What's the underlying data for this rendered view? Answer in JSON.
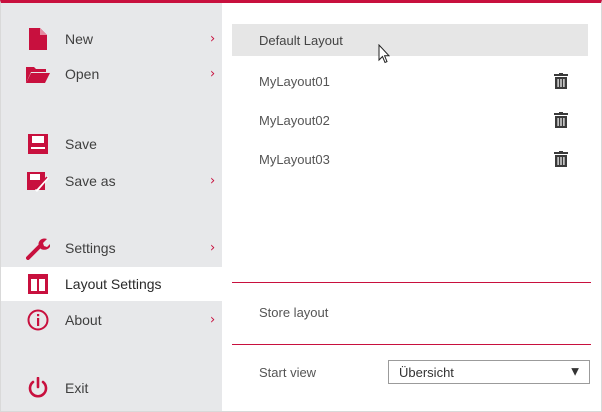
{
  "menu": {
    "new_label": "New",
    "open_label": "Open",
    "save_label": "Save",
    "save_as_label": "Save as",
    "settings_label": "Settings",
    "layout_settings_label": "Layout Settings",
    "about_label": "About",
    "exit_label": "Exit",
    "arrow": "›",
    "icons": [
      "new-document-icon",
      "open-folder-icon",
      "save-disk-icon",
      "save-as-icon",
      "wrench-icon",
      "layout-icon",
      "info-icon",
      "power-icon"
    ]
  },
  "layouts": {
    "default": "Default Layout",
    "items": [
      "MyLayout01",
      "MyLayout02",
      "MyLayout03"
    ]
  },
  "store_layout_label": "Store layout",
  "start_view": {
    "label": "Start view",
    "value": "Übersicht",
    "arrow": "▼"
  },
  "colors": {
    "accent": "#c8103e",
    "sidebar_bg": "#e7e8ea",
    "selected_row": "#e6e6e6"
  }
}
